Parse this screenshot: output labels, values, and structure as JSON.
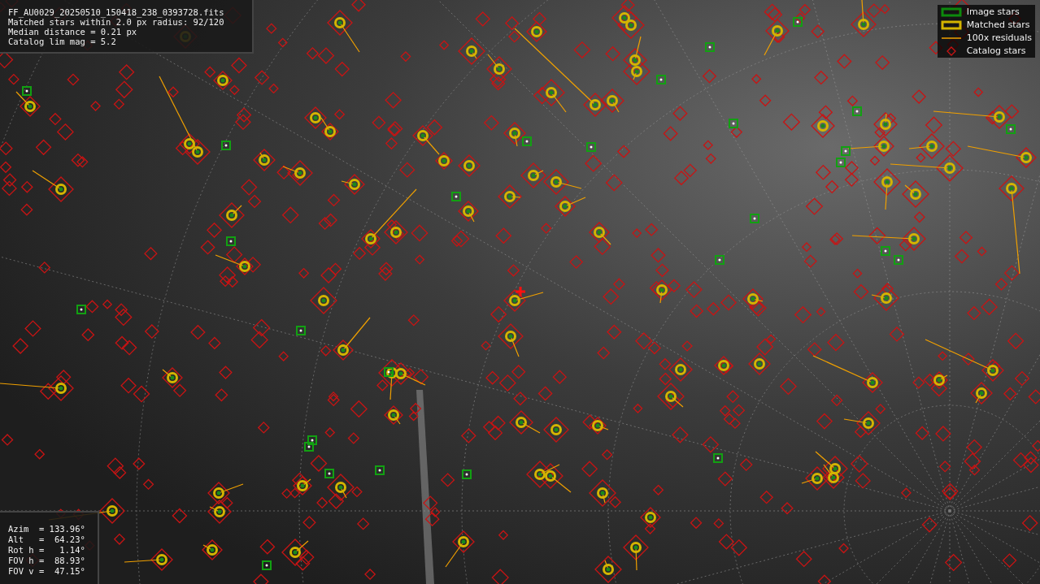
{
  "header": {
    "lines": [
      "FF_AU0029_20250510_150418_238_0393728.fits",
      "Matched stars within 2.0 px radius: 92/120",
      "Median distance = 0.21 px",
      "Catalog lim mag = 5.2"
    ]
  },
  "legend": {
    "items": [
      {
        "kind": "image",
        "label": "Image stars"
      },
      {
        "kind": "matched",
        "label": "Matched stars"
      },
      {
        "kind": "residual",
        "label": "100x residuals"
      },
      {
        "kind": "catalog",
        "label": "Catalog stars"
      }
    ]
  },
  "pointing": {
    "lines": [
      "Azim  = 133.96°",
      "Alt   =  64.23°",
      "Rot h =   1.14°",
      "FOV h =  88.93°",
      "FOV v =  47.15°"
    ]
  }
}
